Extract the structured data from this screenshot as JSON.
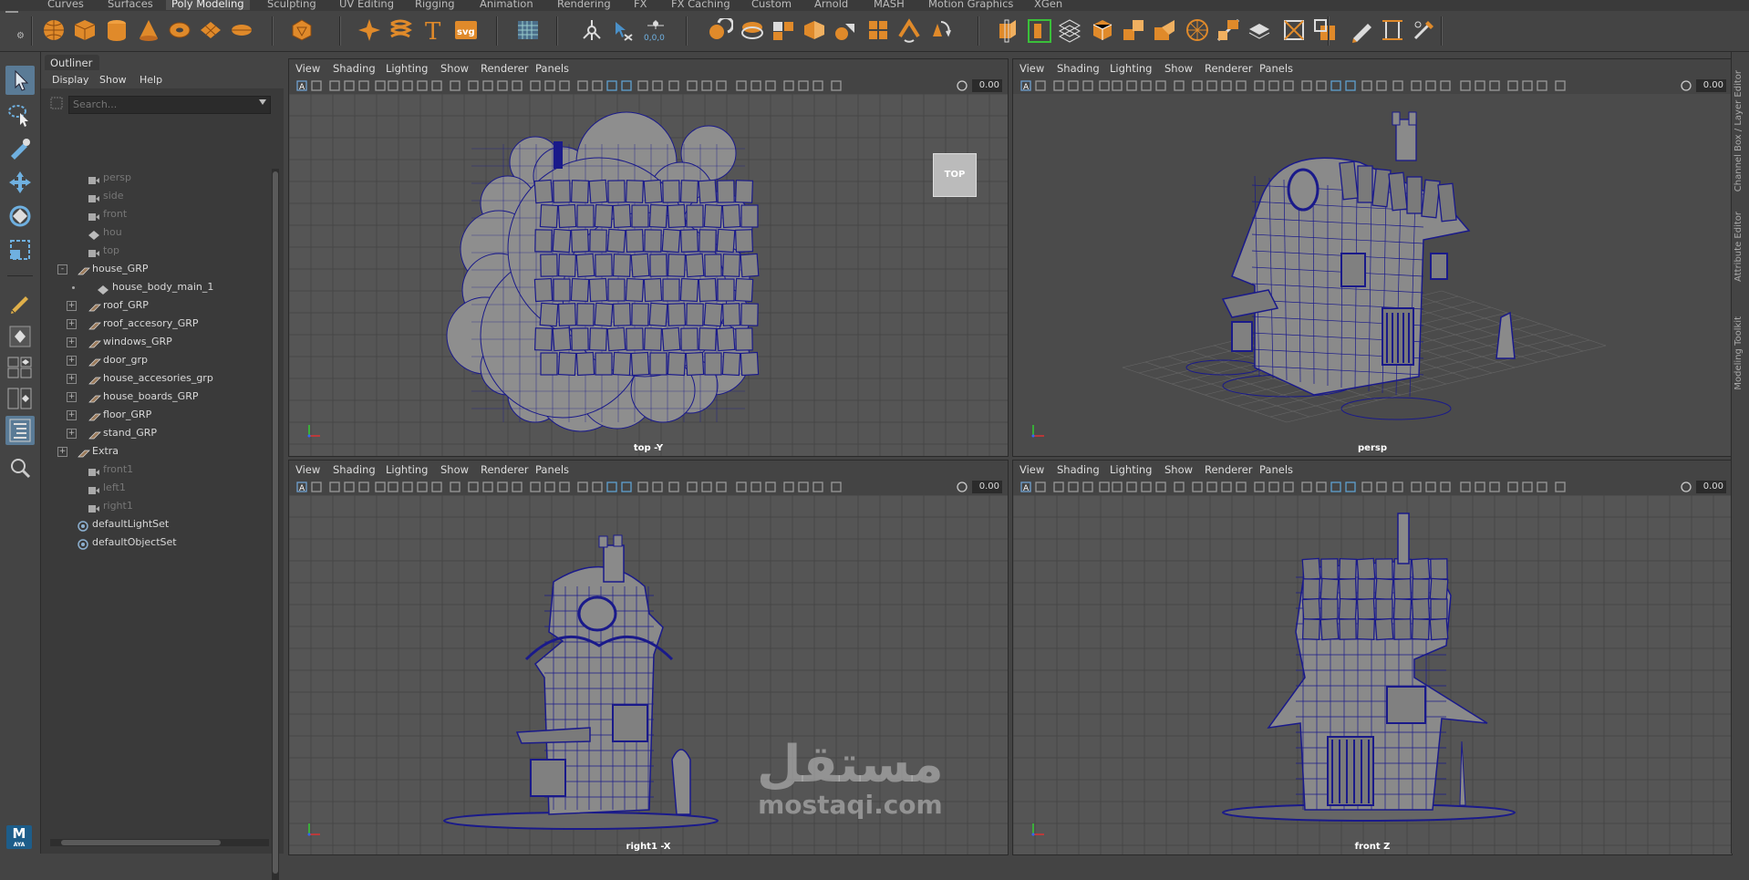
{
  "shelf_tabs": [
    "Curves",
    "Surfaces",
    "Poly Modeling",
    "Sculpting",
    "UV Editing",
    "Rigging",
    "Animation",
    "Rendering",
    "FX",
    "FX Caching",
    "Custom",
    "Arnold",
    "MASH",
    "Motion Graphics",
    "XGen"
  ],
  "shelf_active": "Poly Modeling",
  "shelf_icons": [
    "poly-sphere-icon",
    "poly-cube-icon",
    "poly-cylinder-icon",
    "poly-cone-icon",
    "poly-torus-icon",
    "poly-plane-icon",
    "poly-disc-icon",
    "platonic-solid-icon",
    "super-shape-icon",
    "sweep-mesh-icon",
    "type-text-icon",
    "svg-icon",
    "grid-icon",
    "move-pivot-icon",
    "snap-icon",
    "xyz-coords-icon",
    "combine-icon",
    "separate-icon",
    "smooth-icon",
    "boolean-icon",
    "mirror-icon",
    "bevel-icon",
    "bridge-icon",
    "extrude-icon",
    "multi-cut-icon",
    "target-weld-icon",
    "insert-edge-loop-icon",
    "offset-edge-icon",
    "fill-hole-icon",
    "triangulate-icon",
    "quadrangulate-icon",
    "append-icon",
    "poke-icon",
    "wedge-icon",
    "circularize-icon",
    "bevel-select-icon",
    "edit-pen-icon",
    "crease-icon",
    "sculpt-brush-icon"
  ],
  "shelf_coords": "0,0,0",
  "outliner": {
    "title": "Outliner",
    "menu": [
      "Display",
      "Show",
      "Help"
    ],
    "search_placeholder": "Search...",
    "rows": [
      {
        "label": "persp",
        "dim": true,
        "indent": 1,
        "icon": "camera"
      },
      {
        "label": "side",
        "dim": true,
        "indent": 1,
        "icon": "camera"
      },
      {
        "label": "front",
        "dim": true,
        "indent": 1,
        "icon": "camera"
      },
      {
        "label": "hou",
        "dim": true,
        "indent": 1,
        "icon": "mesh"
      },
      {
        "label": "top",
        "dim": true,
        "indent": 1,
        "icon": "camera"
      },
      {
        "label": "house_GRP",
        "dim": false,
        "indent": 0,
        "icon": "group",
        "expander": "-"
      },
      {
        "label": "house_body_main_1",
        "dim": false,
        "indent": 2,
        "icon": "mesh"
      },
      {
        "label": "roof_GRP",
        "dim": false,
        "indent": 1,
        "icon": "group",
        "expander": "+"
      },
      {
        "label": "roof_accesory_GRP",
        "dim": false,
        "indent": 1,
        "icon": "group",
        "expander": "+"
      },
      {
        "label": "windows_GRP",
        "dim": false,
        "indent": 1,
        "icon": "group",
        "expander": "+"
      },
      {
        "label": "door_grp",
        "dim": false,
        "indent": 1,
        "icon": "group",
        "expander": "+"
      },
      {
        "label": "house_accesories_grp",
        "dim": false,
        "indent": 1,
        "icon": "group",
        "expander": "+"
      },
      {
        "label": "house_boards_GRP",
        "dim": false,
        "indent": 1,
        "icon": "group",
        "expander": "+"
      },
      {
        "label": "floor_GRP",
        "dim": false,
        "indent": 1,
        "icon": "group",
        "expander": "+"
      },
      {
        "label": "stand_GRP",
        "dim": false,
        "indent": 1,
        "icon": "group",
        "expander": "+"
      },
      {
        "label": "Extra",
        "dim": false,
        "indent": 0,
        "icon": "group",
        "expander": "+"
      },
      {
        "label": "front1",
        "dim": true,
        "indent": 1,
        "icon": "camera"
      },
      {
        "label": "left1",
        "dim": true,
        "indent": 1,
        "icon": "camera"
      },
      {
        "label": "right1",
        "dim": true,
        "indent": 1,
        "icon": "camera"
      },
      {
        "label": "defaultLightSet",
        "dim": false,
        "indent": 0,
        "icon": "set"
      },
      {
        "label": "defaultObjectSet",
        "dim": false,
        "indent": 0,
        "icon": "set"
      }
    ]
  },
  "viewport_menu": [
    "View",
    "Shading",
    "Lighting",
    "Show",
    "Renderer",
    "Panels"
  ],
  "viewports": [
    {
      "id": "top",
      "label": "top -Y",
      "value": "0.00",
      "cube": "TOP"
    },
    {
      "id": "persp",
      "label": "persp",
      "value": "0.00"
    },
    {
      "id": "right",
      "label": "right1 -X",
      "value": "0.00"
    },
    {
      "id": "front",
      "label": "front Z",
      "value": "0.00"
    }
  ],
  "right_panel": [
    "Channel Box / Layer Editor",
    "Attribute Editor",
    "Modeling Toolkit"
  ],
  "logo": {
    "letter": "M",
    "text": "AYA"
  },
  "watermark": {
    "arabic": "مستقل",
    "latin": "mostaqi.com"
  },
  "colors": {
    "accent": "#e08a2a",
    "wire": "#1a1a8a",
    "active_blue": "#5a7b96"
  }
}
